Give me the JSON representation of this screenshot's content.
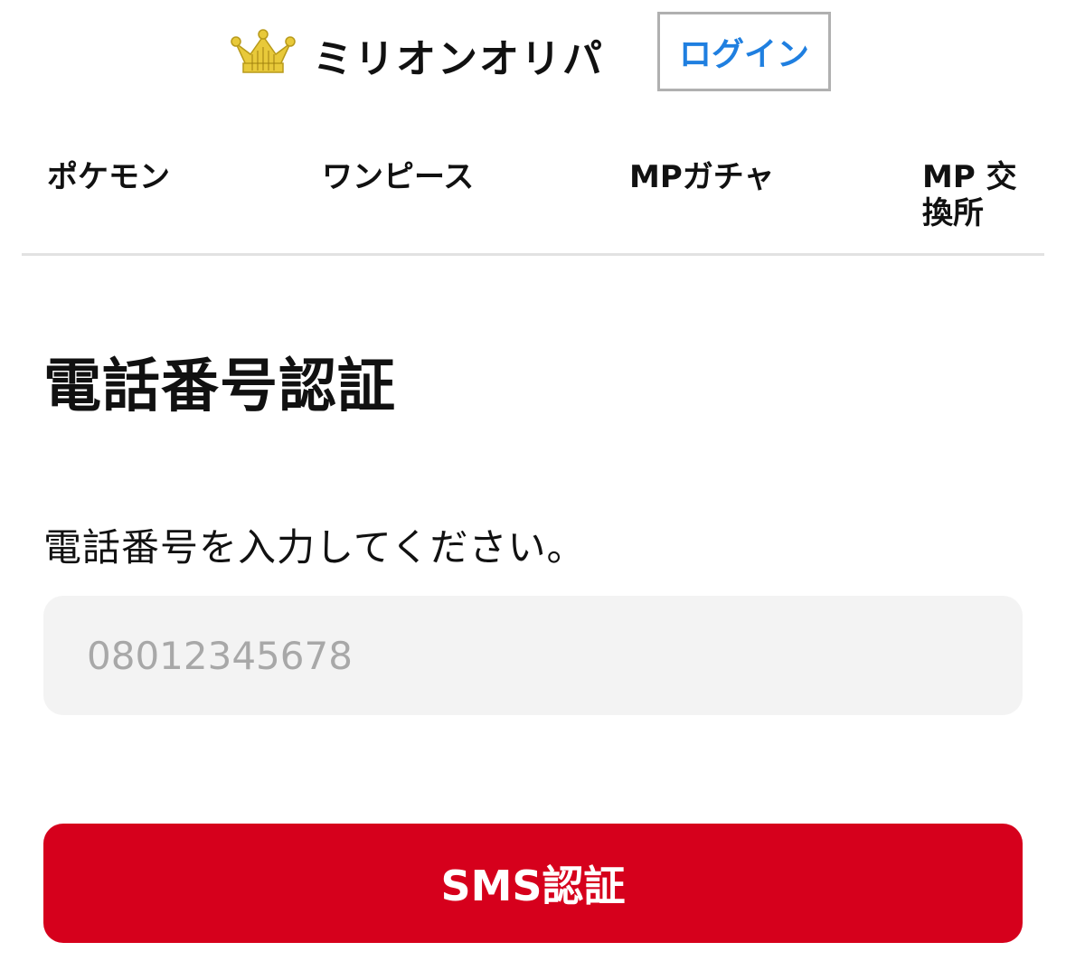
{
  "header": {
    "logo_icon": "crown-icon",
    "brand_name": "ミリオンオリパ",
    "login_label": "ログイン",
    "accent_color": "#1f7fe0"
  },
  "nav": {
    "items": [
      {
        "label": "ポケモン"
      },
      {
        "label": "ワンピース"
      },
      {
        "label": "MPガチャ"
      },
      {
        "label": "MP 交換所"
      }
    ]
  },
  "main": {
    "title": "電話番号認証",
    "instruction": "電話番号を入力してください。",
    "phone_input": {
      "value": "",
      "placeholder": "08012345678"
    },
    "submit_label": "SMS認証",
    "submit_color": "#d6001c"
  }
}
